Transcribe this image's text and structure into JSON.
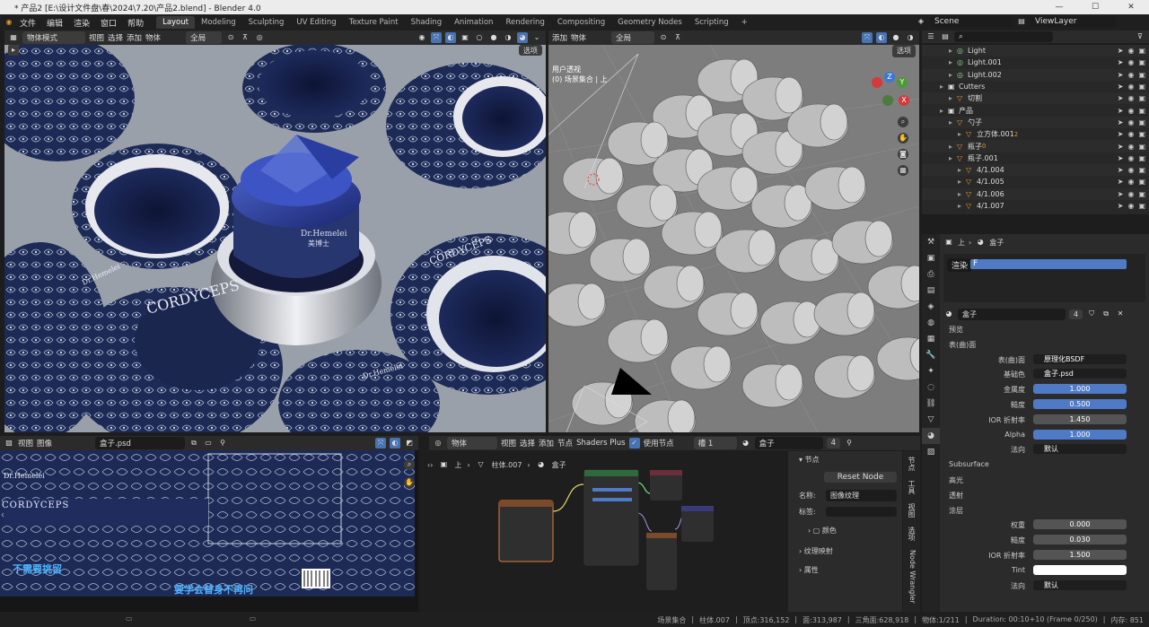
{
  "window": {
    "title": "* 产品2 [E:\\设计文件盘\\春\\2024\\7.20\\产品2.blend] - Blender 4.0",
    "controls": [
      "—",
      "☐",
      "✕"
    ]
  },
  "menu": [
    "文件",
    "编辑",
    "渲染",
    "窗口",
    "帮助"
  ],
  "workspaces": [
    "Layout",
    "Modeling",
    "Sculpting",
    "UV Editing",
    "Texture Paint",
    "Shading",
    "Animation",
    "Rendering",
    "Compositing",
    "Geometry Nodes",
    "Scripting",
    "+"
  ],
  "scene": {
    "scene_name": "Scene",
    "view_layer": "ViewLayer"
  },
  "viewport_left": {
    "mode": "物体模式",
    "menus": [
      "视图",
      "选择",
      "添加",
      "物体"
    ],
    "orientation": "全局",
    "options": "选项"
  },
  "viewport_right": {
    "menus": [
      "添加",
      "物体"
    ],
    "orientation": "全局",
    "options": "选项",
    "overlay_line1": "用户透视",
    "overlay_line2": "(0) 场景集合 | 上"
  },
  "label_text": {
    "brand1": "Dr.Hemelei",
    "brand2": "CORDYCEPS",
    "brand3": "Dr.Hemelei",
    "brand4": "CORDYCEPS",
    "lid_brand": "Dr.Hemelei",
    "lid_sub": "美博士"
  },
  "outliner": {
    "search_placeholder": "",
    "rows": [
      {
        "indent": 2,
        "name": "Light",
        "icon": "light"
      },
      {
        "indent": 2,
        "name": "Light.001",
        "icon": "light"
      },
      {
        "indent": 2,
        "name": "Light.002",
        "icon": "light"
      },
      {
        "indent": 1,
        "name": "Cutters",
        "icon": "collection"
      },
      {
        "indent": 2,
        "name": "切割",
        "icon": "mesh"
      },
      {
        "indent": 1,
        "name": "产品",
        "icon": "collection"
      },
      {
        "indent": 2,
        "name": "勺子",
        "icon": "mesh"
      },
      {
        "indent": 3,
        "name": "立方体.001",
        "icon": "mesh",
        "badge": "2"
      },
      {
        "indent": 2,
        "name": "瓶子",
        "icon": "mesh",
        "badge": "0"
      },
      {
        "indent": 2,
        "name": "瓶子.001",
        "icon": "mesh"
      },
      {
        "indent": 3,
        "name": "4/1.004",
        "icon": "mesh"
      },
      {
        "indent": 3,
        "name": "4/1.005",
        "icon": "mesh"
      },
      {
        "indent": 3,
        "name": "4/1.006",
        "icon": "mesh"
      },
      {
        "indent": 3,
        "name": "4/1.007",
        "icon": "mesh"
      }
    ]
  },
  "properties": {
    "crumb_left": "上",
    "crumb_right": "盒子",
    "slot_menu": "渲染",
    "slot_value": "F",
    "material_name": "盒子",
    "user_count": "4",
    "sections": {
      "preview": "预览",
      "surface": "表(曲)面",
      "subsurface": "Subsurface",
      "specular": "高光",
      "transmission": "透射",
      "coat": "涂层"
    },
    "rows": [
      {
        "label": "表(曲)面",
        "value": "原理化BSDF",
        "style": "dark"
      },
      {
        "label": "基础色",
        "value": "盒子.psd",
        "style": "dark"
      },
      {
        "label": "金属度",
        "value": "1.000",
        "style": "blue"
      },
      {
        "label": "糙度",
        "value": "0.500",
        "style": "blue"
      },
      {
        "label": "IOR 折射率",
        "value": "1.450",
        "style": ""
      },
      {
        "label": "Alpha",
        "value": "1.000",
        "style": "blue"
      },
      {
        "label": "法向",
        "value": "默认",
        "style": "dark"
      }
    ],
    "coat_rows": [
      {
        "label": "权重",
        "value": "0.000",
        "style": ""
      },
      {
        "label": "糙度",
        "value": "0.030",
        "style": ""
      },
      {
        "label": "IOR 折射率",
        "value": "1.500",
        "style": ""
      },
      {
        "label": "Tint",
        "value": "",
        "style": "white"
      },
      {
        "label": "法向",
        "value": "默认",
        "style": "dark"
      }
    ]
  },
  "image_editor": {
    "menus": [
      "视图",
      "图像"
    ],
    "image_name": "盒子.psd",
    "overlay_cn1": "不需要挑留",
    "overlay_cn2": "要学会替身不再问"
  },
  "node_editor": {
    "type": "物体",
    "menus": [
      "视图",
      "选择",
      "添加",
      "节点"
    ],
    "shaders_plus": "Shaders Plus",
    "use_nodes": "使用节点",
    "slot": "槽 1",
    "material": "盒子",
    "users": "4",
    "crumb": [
      "上",
      "柱体.007",
      "盒子"
    ]
  },
  "node_sidebar": {
    "section": "节点",
    "reset": "Reset Node",
    "name_label": "名称:",
    "name_value": "图像纹理",
    "label_label": "标签:",
    "color": "颜色",
    "texture_mapping": "纹理映射",
    "properties": "属性",
    "tabs": [
      "节点",
      "工具",
      "视图",
      "选项",
      "Node Wrangler"
    ]
  },
  "status": {
    "collection": "场景集合",
    "object": "柱体.007",
    "verts": "顶点:316,152",
    "faces": "面:313,987",
    "tris": "三角面:628,918",
    "objects": "物体:1/211",
    "duration": "Duration: 00:10+10 (Frame 0/250)",
    "memory": "内存: 851"
  }
}
